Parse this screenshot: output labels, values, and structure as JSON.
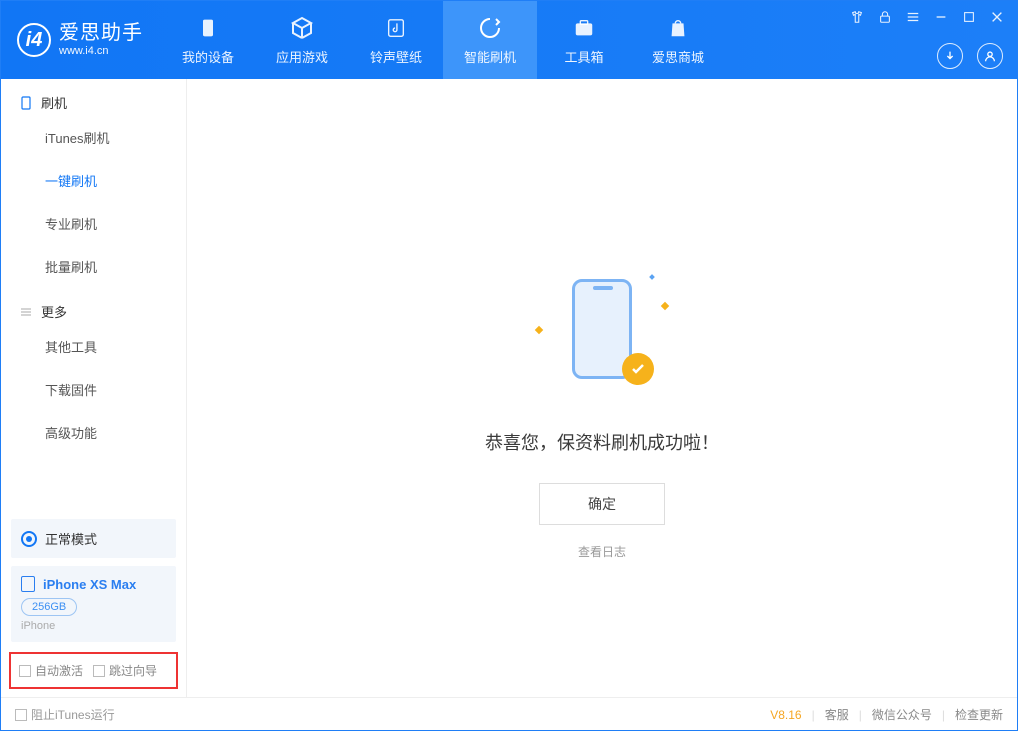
{
  "app": {
    "name": "爱思助手",
    "url": "www.i4.cn"
  },
  "tabs": {
    "device": "我的设备",
    "apps": "应用游戏",
    "ringtone": "铃声壁纸",
    "flash": "智能刷机",
    "toolbox": "工具箱",
    "store": "爱思商城"
  },
  "sidebar": {
    "section1": "刷机",
    "items1": [
      "iTunes刷机",
      "一键刷机",
      "专业刷机",
      "批量刷机"
    ],
    "section2": "更多",
    "items2": [
      "其他工具",
      "下载固件",
      "高级功能"
    ],
    "mode": "正常模式",
    "device_name": "iPhone XS Max",
    "device_capacity": "256GB",
    "device_os": "iPhone",
    "checks": {
      "auto_activate": "自动激活",
      "skip_wizard": "跳过向导"
    }
  },
  "content": {
    "message": "恭喜您，保资料刷机成功啦！",
    "ok": "确定",
    "log": "查看日志"
  },
  "footer": {
    "block_itunes": "阻止iTunes运行",
    "version": "V8.16",
    "support": "客服",
    "wechat": "微信公众号",
    "update": "检查更新"
  }
}
